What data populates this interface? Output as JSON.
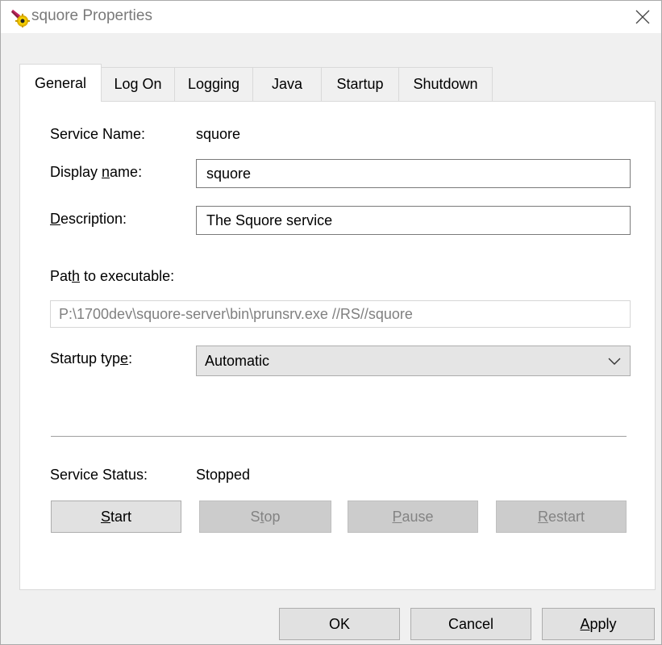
{
  "window": {
    "title": "squore Properties",
    "icon": "service-gear-icon",
    "close_icon": "close-icon"
  },
  "tabs": [
    {
      "label": "General",
      "active": true
    },
    {
      "label": "Log On",
      "active": false
    },
    {
      "label": "Logging",
      "active": false
    },
    {
      "label": "Java",
      "active": false
    },
    {
      "label": "Startup",
      "active": false
    },
    {
      "label": "Shutdown",
      "active": false
    }
  ],
  "general": {
    "service_name_label": "Service Name:",
    "service_name_value": "squore",
    "display_name": {
      "label_pre": "Display ",
      "label_key": "n",
      "label_post": "ame:",
      "value": "squore"
    },
    "description": {
      "label_pre": "",
      "label_key": "D",
      "label_post": "escription:",
      "value": "The Squore service"
    },
    "path": {
      "label_pre": "Pat",
      "label_key": "h",
      "label_post": " to executable:",
      "value": "P:\\1700dev\\squore-server\\bin\\prunsrv.exe //RS//squore"
    },
    "startup_type": {
      "label_pre": "Startup typ",
      "label_key": "e",
      "label_post": ":",
      "value": "Automatic"
    },
    "service_status_label": "Service Status:",
    "service_status_value": "Stopped"
  },
  "service_buttons": [
    {
      "pre": "",
      "key": "S",
      "post": "tart",
      "enabled": true
    },
    {
      "pre": "S",
      "key": "t",
      "post": "op",
      "enabled": false
    },
    {
      "pre": "",
      "key": "P",
      "post": "ause",
      "enabled": false
    },
    {
      "pre": "",
      "key": "R",
      "post": "estart",
      "enabled": false
    }
  ],
  "dialog_buttons": {
    "ok": "OK",
    "cancel": "Cancel",
    "apply_key": "A",
    "apply_post": "pply"
  }
}
